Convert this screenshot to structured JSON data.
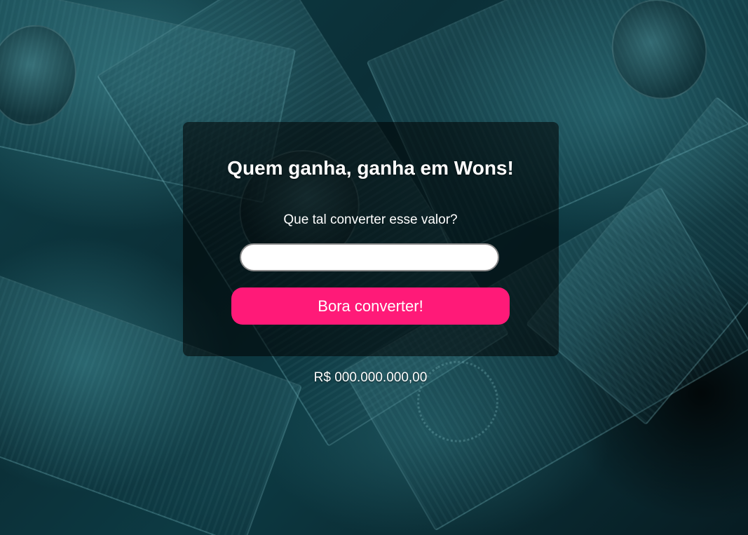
{
  "page": {
    "title": "Quem ganha, ganha em Wons!",
    "subtitle": "Que tal converter esse valor?",
    "amount_input": {
      "value": "",
      "placeholder": ""
    },
    "convert_button_label": "Bora converter!",
    "result_text": "R$ 000.000.000,00"
  },
  "colors": {
    "accent": "#ff1a78",
    "background_tint": "#0b2f37",
    "text": "#ffffff"
  }
}
